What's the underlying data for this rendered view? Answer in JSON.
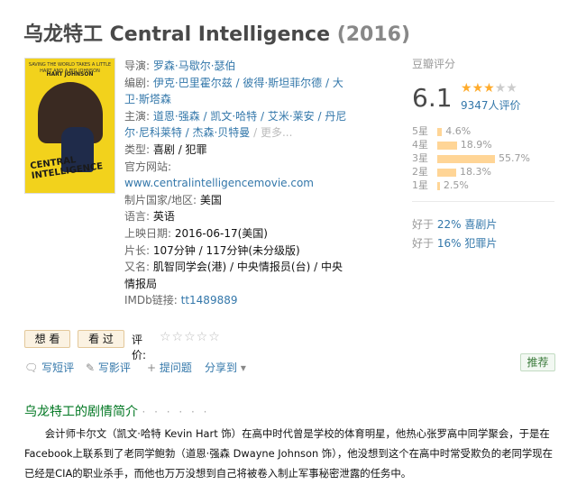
{
  "movie": {
    "title": "乌龙特工 Central Intelligence",
    "year": "(2016)"
  },
  "poster": {
    "top_text": "SAVING THE WORLD TAKES A LITTLE HART AND A BIG JOHNSON",
    "names": "HART   JOHNSON",
    "title_text": "CENTRAL INTELLIGENCE"
  },
  "info": {
    "director_label": "导演",
    "director": "罗森·马歇尔·瑟伯",
    "writer_label": "编剧",
    "writer": "伊克·巴里霍尔兹 / 彼得·斯坦菲尔德 / 大卫·斯塔森",
    "cast_label": "主演",
    "cast": "道恩·强森 / 凯文·哈特 / 艾米·莱安 / 丹尼尔·尼科莱特 / 杰森·贝特曼",
    "cast_more": " / 更多...",
    "genre_label": "类型",
    "genre": "喜剧 / 犯罪",
    "site_label": "官方网站",
    "site": "www.centralintelligencemovie.com",
    "country_label": "制片国家/地区",
    "country": "美国",
    "language_label": "语言",
    "language": "英语",
    "release_label": "上映日期",
    "release": "2016-06-17(美国)",
    "runtime_label": "片长",
    "runtime": "107分钟 / 117分钟(未分级版)",
    "aka_label": "又名",
    "aka": "肌智同学会(港) / 中央情报员(台) / 中央情报局",
    "imdb_label": "IMDb链接",
    "imdb": "tt1489889"
  },
  "rating": {
    "title": "豆瓣评分",
    "score": "6.1",
    "stars_filled": 3,
    "stars_total": 5,
    "votes": "9347人评价",
    "distribution": [
      {
        "label": "5星",
        "percent": 4.6,
        "text": "4.6%"
      },
      {
        "label": "4星",
        "percent": 18.9,
        "text": "18.9%"
      },
      {
        "label": "3星",
        "percent": 55.7,
        "text": "55.7%"
      },
      {
        "label": "2星",
        "percent": 18.3,
        "text": "18.3%"
      },
      {
        "label": "1星",
        "percent": 2.5,
        "text": "2.5%"
      }
    ],
    "better_than": [
      {
        "prefix": "好于 ",
        "value": "22% 喜剧片"
      },
      {
        "prefix": "好于 ",
        "value": "16% 犯罪片"
      }
    ]
  },
  "actions": {
    "want": "想 看",
    "seen": "看 过",
    "rate_label": "评价:",
    "rate_stars": "☆☆☆☆☆"
  },
  "social": {
    "short_review": "写短评",
    "review": "写影评",
    "question": "提问题",
    "share": "分享到",
    "recommend": "推荐"
  },
  "summary": {
    "title": "乌龙特工的剧情简介",
    "dots": "· · · · · ·",
    "text": "　　会计师卡尔文（凯文·哈特 Kevin Hart 饰）在高中时代曾是学校的体育明星，他热心张罗高中同学聚会，于是在Facebook上联系到了老同学鲍勃（道恩·强森 Dwayne Johnson 饰），他没想到这个在高中时常受欺负的老同学现在已经是CIA的职业杀手，而他也万万没想到自己将被卷入制止军事秘密泄露的任务中。"
  },
  "colors": {
    "link": "#3377aa",
    "star": "#ffac2d",
    "bar": "#ffd596",
    "summary_title": "#007722"
  },
  "icons": {
    "short_review": "speech-bubble-icon",
    "review": "pencil-icon",
    "question": "plus-icon",
    "share": "dropdown-caret-icon"
  }
}
